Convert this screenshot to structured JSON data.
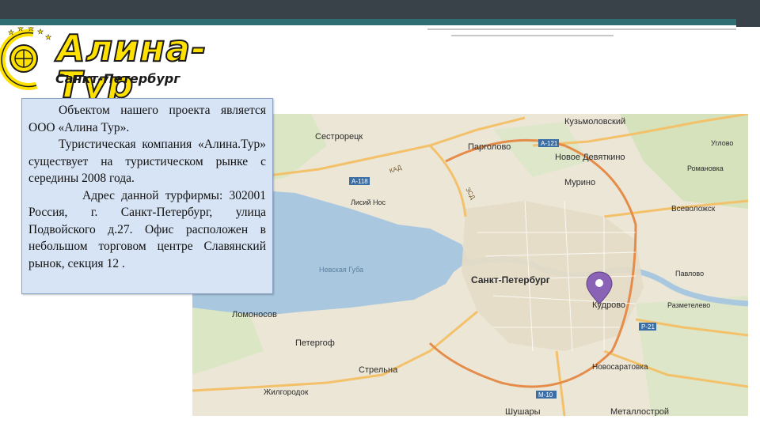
{
  "slide": {
    "logo": {
      "title": "Алина-Тур",
      "subtitle": "Санкт-Петербург"
    },
    "text": {
      "paragraph1": "Объектом нашего проекта является ООО «Алина Тур».",
      "paragraph2": "Туристическая компания «Алина.Тур» существует на туристическом рынке с середины 2008 года.",
      "paragraph3": "Адрес данной турфирмы: 302001 Россия, г. Санкт-Петербург, улица Подвойского д.27. Офис расположен в небольшом торговом центре Славянский рынок, секция 12 ."
    }
  },
  "map": {
    "labels": {
      "kuzmolovsky": "Кузьмоловский",
      "sestroretsk": "Сестрорецк",
      "pargolovo": "Парголово",
      "novoe_devyatkino": "Новое Девяткино",
      "murino": "Мурино",
      "lisiy_nos": "Лисий Нос",
      "vsevolozhsk": "Всеволожск",
      "romanovka": "Романовка",
      "uglovo": "Углово",
      "nevskaya_guba": "Невская Губа",
      "saint_petersburg": "Санкт-Петербург",
      "kudrovo": "Кудрово",
      "pavlovo": "Павлово",
      "razmetelevo": "Разметелево",
      "lomonosov": "Ломоносов",
      "peterhof": "Петергоф",
      "strelna": "Стрельна",
      "novosaratovka": "Новосаратовка",
      "zhilgorodok": "Жилгородок",
      "shushary": "Шушары",
      "metallostroy": "Металлострой",
      "kad": "КАД",
      "zsd": "ЗСД",
      "a118": "А-118",
      "a121": "А-121",
      "m10": "М-10",
      "p21": "Р-21"
    }
  }
}
